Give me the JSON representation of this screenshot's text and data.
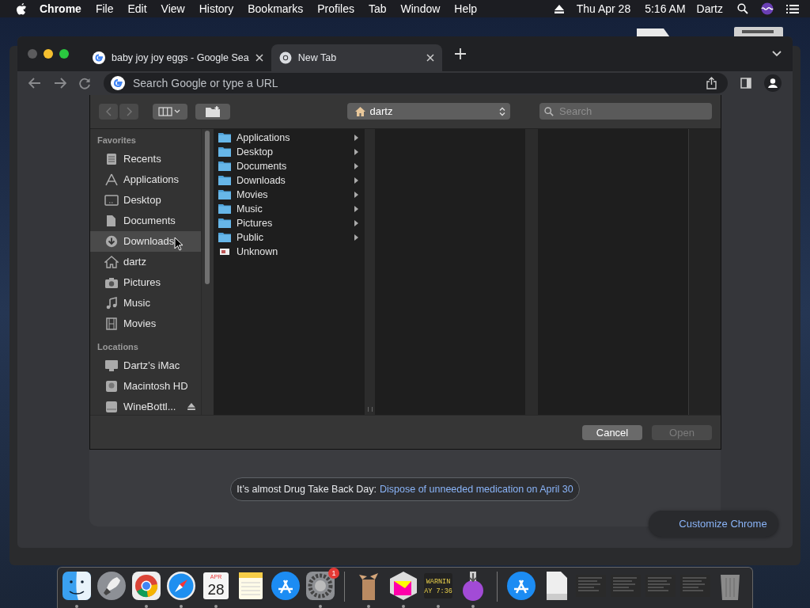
{
  "menu_bar": {
    "app": "Chrome",
    "menus": [
      "File",
      "Edit",
      "View",
      "History",
      "Bookmarks",
      "Profiles",
      "Tab",
      "Window",
      "Help"
    ],
    "date": "Thu Apr 28",
    "time": "5:16 AM",
    "user": "Dartz"
  },
  "browser": {
    "tabs": [
      {
        "title": "baby joy joy eggs - Google Sea",
        "selected": false
      },
      {
        "title": "New Tab",
        "selected": true
      }
    ],
    "omnibox": {
      "placeholder": "Search Google or type a URL"
    }
  },
  "new_tab_page": {
    "promo": {
      "text": "It’s almost Drug Take Back Day:",
      "link": "Dispose of unneeded medication on April 30"
    },
    "customize_button": "Customize Chrome"
  },
  "open_dialog": {
    "location": "dartz",
    "search": {
      "placeholder": "Search"
    },
    "sidebar": [
      {
        "heading": "Favorites",
        "items": [
          {
            "label": "Recents",
            "selected": false
          },
          {
            "label": "Applications",
            "selected": false
          },
          {
            "label": "Desktop",
            "selected": false
          },
          {
            "label": "Documents",
            "selected": false
          },
          {
            "label": "Downloads",
            "selected": true
          },
          {
            "label": "dartz",
            "selected": false
          },
          {
            "label": "Pictures",
            "selected": false
          },
          {
            "label": "Music",
            "selected": false
          },
          {
            "label": "Movies",
            "selected": false
          }
        ]
      },
      {
        "heading": "Locations",
        "items": [
          {
            "label": "Dartz’s iMac",
            "selected": false
          },
          {
            "label": "Macintosh HD",
            "selected": false
          },
          {
            "label": "WineBottl...",
            "selected": false,
            "eject": true
          }
        ]
      }
    ],
    "column": [
      {
        "name": "Applications",
        "kind": "folder"
      },
      {
        "name": "Desktop",
        "kind": "folder"
      },
      {
        "name": "Documents",
        "kind": "folder"
      },
      {
        "name": "Downloads",
        "kind": "folder"
      },
      {
        "name": "Movies",
        "kind": "folder"
      },
      {
        "name": "Music",
        "kind": "folder"
      },
      {
        "name": "Pictures",
        "kind": "folder"
      },
      {
        "name": "Public",
        "kind": "folder"
      },
      {
        "name": "Unknown",
        "kind": "file"
      }
    ],
    "buttons": [
      {
        "label": "Cancel",
        "disabled": false
      },
      {
        "label": "Open",
        "disabled": true
      }
    ]
  },
  "dock": {
    "items": [
      {
        "kind": "finder",
        "running": true
      },
      {
        "kind": "rocket",
        "running": false
      },
      {
        "kind": "chrome",
        "running": true
      },
      {
        "kind": "compass",
        "running": true
      },
      {
        "kind": "calendar",
        "running": true,
        "month": "APR",
        "day": "28"
      },
      {
        "kind": "notepad",
        "running": false
      },
      {
        "kind": "appstore",
        "running": false
      },
      {
        "kind": "gear",
        "running": true,
        "badge": "1"
      },
      {
        "kind": "separator"
      },
      {
        "kind": "box",
        "running": true
      },
      {
        "kind": "cube",
        "running": true
      },
      {
        "kind": "console",
        "running": true,
        "lines": [
          "WARNIN",
          "AY 7:36"
        ]
      },
      {
        "kind": "flask",
        "running": true
      },
      {
        "kind": "separator"
      },
      {
        "kind": "appstore",
        "running": false
      },
      {
        "kind": "document",
        "running": false
      },
      {
        "kind": "thumbnail",
        "running": false
      },
      {
        "kind": "thumbnail",
        "running": false
      },
      {
        "kind": "thumbnail",
        "running": false
      },
      {
        "kind": "thumbnail",
        "running": false
      },
      {
        "kind": "trash",
        "running": false
      }
    ]
  }
}
